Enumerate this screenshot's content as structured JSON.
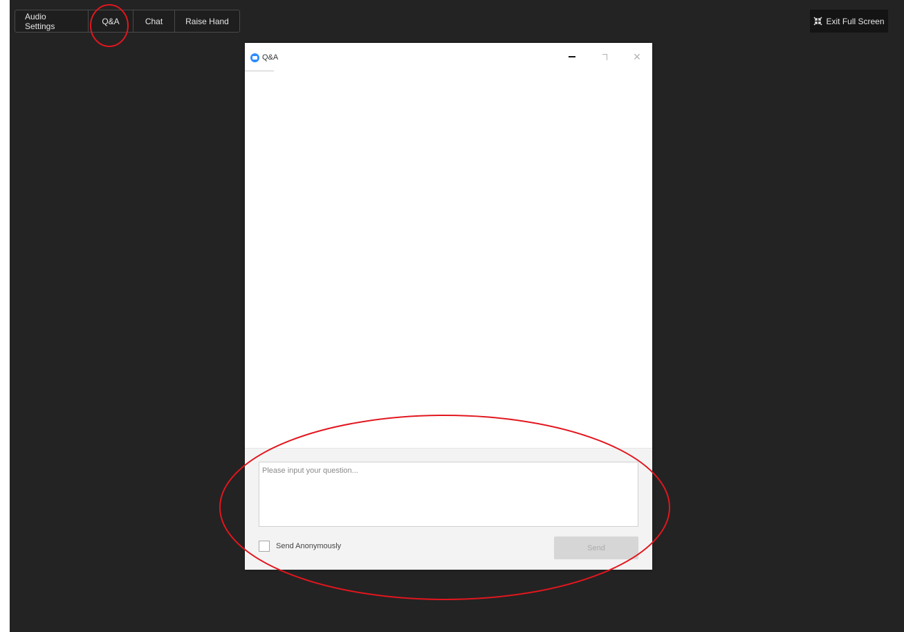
{
  "toolbar": {
    "audio_settings": "Audio Settings",
    "qa": "Q&A",
    "chat": "Chat",
    "raise_hand": "Raise Hand"
  },
  "exit_full_screen": {
    "label": "Exit Full Screen",
    "icon": "collapse-arrows-icon"
  },
  "qa_window": {
    "title": "Q&A",
    "logo": "zoom-logo-icon",
    "controls": {
      "minimize": "minimize-icon",
      "maximize": "maximize-icon",
      "close": "close-icon",
      "close_glyph": "×"
    },
    "composer": {
      "placeholder": "Please input your question...",
      "value": "",
      "anonymous_label": "Send Anonymously",
      "anonymous_checked": false,
      "send_label": "Send"
    }
  },
  "annotation_color": "#e2161e",
  "colors": {
    "background": "#232323",
    "zoom_blue": "#2d8cff"
  }
}
